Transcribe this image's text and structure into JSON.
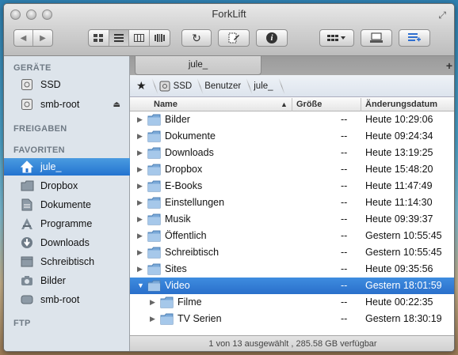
{
  "window": {
    "title": "ForkLift"
  },
  "toolbar": {
    "back_icon": "chevron-left-icon",
    "forward_icon": "chevron-right-icon",
    "view_modes": [
      "icon-view-icon",
      "list-view-icon",
      "column-view-icon",
      "coverflow-view-icon"
    ],
    "refresh_icon": "refresh-icon",
    "edit_icon": "edit-document-icon",
    "info_icon": "info-icon",
    "action_icon": "action-menu-icon",
    "remote_icon": "computer-icon",
    "queue_icon": "queue-icon"
  },
  "sidebar": {
    "sections": [
      {
        "heading": "GERÄTE",
        "items": [
          {
            "label": "SSD",
            "icon": "drive-icon"
          },
          {
            "label": "smb-root",
            "icon": "drive-icon",
            "eject": "⏏"
          }
        ]
      },
      {
        "heading": "FREIGABEN",
        "items": []
      },
      {
        "heading": "FAVORITEN",
        "items": [
          {
            "label": "jule_",
            "icon": "home-icon",
            "selected": true
          },
          {
            "label": "Dropbox",
            "icon": "folder-icon"
          },
          {
            "label": "Dokumente",
            "icon": "document-icon"
          },
          {
            "label": "Programme",
            "icon": "applications-icon"
          },
          {
            "label": "Downloads",
            "icon": "download-icon"
          },
          {
            "label": "Schreibtisch",
            "icon": "desktop-icon"
          },
          {
            "label": "Bilder",
            "icon": "camera-icon"
          },
          {
            "label": "smb-root",
            "icon": "drive-icon"
          }
        ]
      },
      {
        "heading": "FTP",
        "items": []
      }
    ]
  },
  "tabs": [
    {
      "label": "jule_"
    }
  ],
  "tab_add": "+",
  "path": [
    "SSD",
    "Benutzer",
    "jule_"
  ],
  "columns": {
    "name": "Name",
    "size": "Größe",
    "date": "Änderungsdatum"
  },
  "rows": [
    {
      "name": "Bilder",
      "size": "--",
      "date": "Heute 10:29:06",
      "level": 0,
      "expanded": false
    },
    {
      "name": "Dokumente",
      "size": "--",
      "date": "Heute 09:24:34",
      "level": 0,
      "expanded": false
    },
    {
      "name": "Downloads",
      "size": "--",
      "date": "Heute 13:19:25",
      "level": 0,
      "expanded": false
    },
    {
      "name": "Dropbox",
      "size": "--",
      "date": "Heute 15:48:20",
      "level": 0,
      "expanded": false
    },
    {
      "name": "E-Books",
      "size": "--",
      "date": "Heute 11:47:49",
      "level": 0,
      "expanded": false
    },
    {
      "name": "Einstellungen",
      "size": "--",
      "date": "Heute 11:14:30",
      "level": 0,
      "expanded": false
    },
    {
      "name": "Musik",
      "size": "--",
      "date": "Heute 09:39:37",
      "level": 0,
      "expanded": false
    },
    {
      "name": "Öffentlich",
      "size": "--",
      "date": "Gestern 10:55:45",
      "level": 0,
      "expanded": false
    },
    {
      "name": "Schreibtisch",
      "size": "--",
      "date": "Gestern 10:55:45",
      "level": 0,
      "expanded": false
    },
    {
      "name": "Sites",
      "size": "--",
      "date": "Heute 09:35:56",
      "level": 0,
      "expanded": false
    },
    {
      "name": "Video",
      "size": "--",
      "date": "Gestern 18:01:59",
      "level": 0,
      "expanded": true,
      "selected": true
    },
    {
      "name": "Filme",
      "size": "--",
      "date": "Heute 00:22:35",
      "level": 1,
      "expanded": false
    },
    {
      "name": "TV Serien",
      "size": "--",
      "date": "Gestern 18:30:19",
      "level": 1,
      "expanded": false
    }
  ],
  "status": "1 von 13 ausgewählt , 285.58 GB verfügbar",
  "colors": {
    "selection": "#2a6fcb",
    "sidebar_bg": "#dde4eb",
    "folder": "#7aa9d8"
  }
}
